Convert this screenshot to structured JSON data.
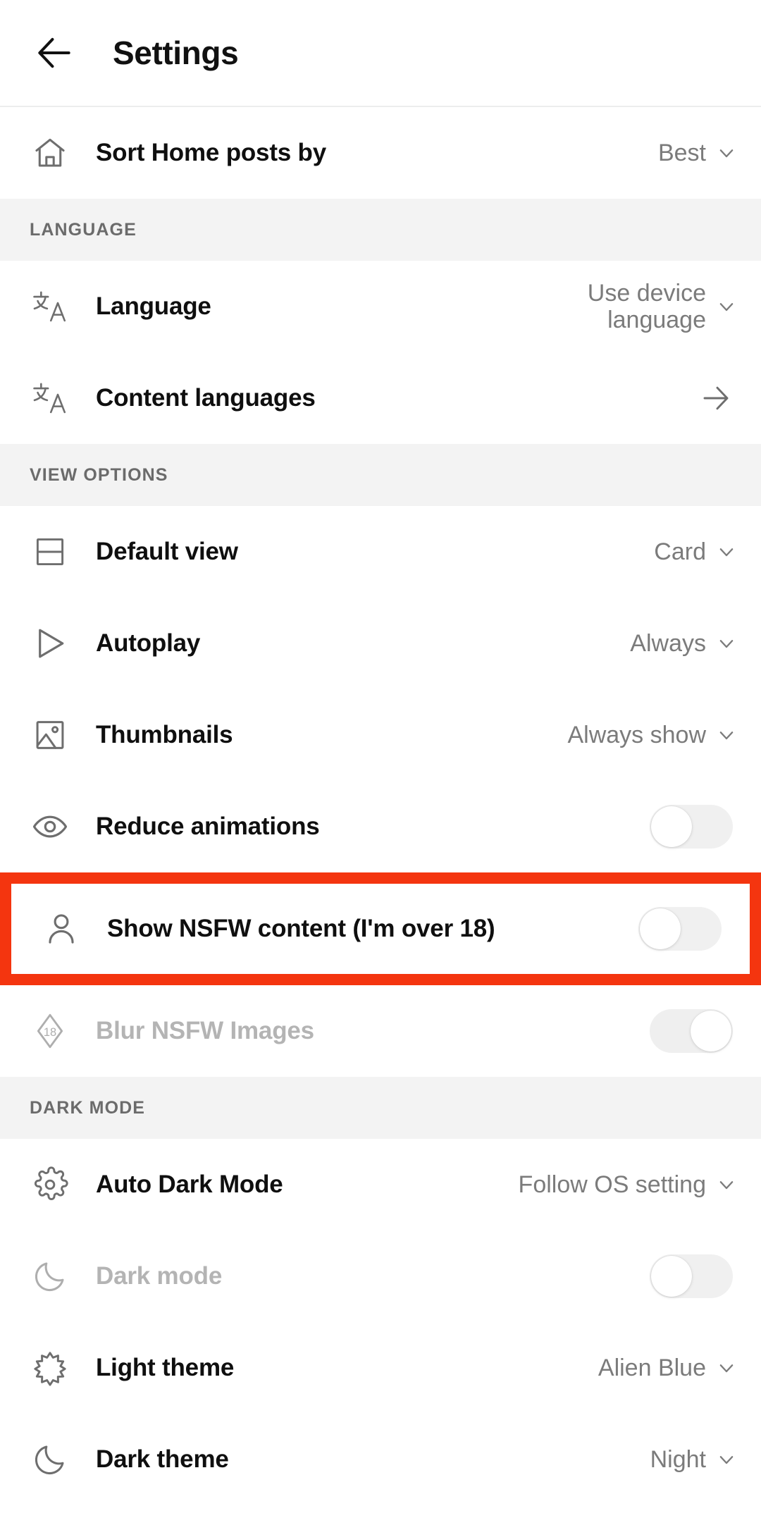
{
  "header": {
    "title": "Settings",
    "back_icon": "arrow-left-icon"
  },
  "sections": [
    {
      "id": "top",
      "heading": null,
      "rows": [
        {
          "id": "sort-home-posts-by",
          "icon": "home-icon",
          "label": "Sort Home posts by",
          "control": "dropdown",
          "value": "Best"
        }
      ]
    },
    {
      "id": "language",
      "heading": "LANGUAGE",
      "rows": [
        {
          "id": "language",
          "icon": "translate-icon",
          "label": "Language",
          "control": "dropdown",
          "value": "Use device language"
        },
        {
          "id": "content-languages",
          "icon": "translate-icon",
          "label": "Content languages",
          "control": "navigate",
          "value": ""
        }
      ]
    },
    {
      "id": "view-options",
      "heading": "VIEW OPTIONS",
      "rows": [
        {
          "id": "default-view",
          "icon": "card-view-icon",
          "label": "Default view",
          "control": "dropdown",
          "value": "Card"
        },
        {
          "id": "autoplay",
          "icon": "play-icon",
          "label": "Autoplay",
          "control": "dropdown",
          "value": "Always"
        },
        {
          "id": "thumbnails",
          "icon": "image-icon",
          "label": "Thumbnails",
          "control": "dropdown",
          "value": "Always show"
        },
        {
          "id": "reduce-animations",
          "icon": "eye-icon",
          "label": "Reduce animations",
          "control": "toggle",
          "toggle_state": "off",
          "disabled": false
        },
        {
          "id": "show-nsfw-content",
          "icon": "person-icon",
          "label": "Show NSFW content (I'm over 18)",
          "control": "toggle",
          "toggle_state": "off",
          "disabled": false,
          "highlighted": true
        },
        {
          "id": "blur-nsfw-images",
          "icon": "eighteen-badge-icon",
          "label": "Blur NSFW Images",
          "control": "toggle",
          "toggle_state": "on",
          "disabled": true
        }
      ]
    },
    {
      "id": "dark-mode",
      "heading": "DARK MODE",
      "rows": [
        {
          "id": "auto-dark-mode",
          "icon": "gear-icon",
          "label": "Auto Dark Mode",
          "control": "dropdown",
          "value": "Follow OS setting"
        },
        {
          "id": "dark-mode",
          "icon": "moon-icon",
          "label": "Dark mode",
          "control": "toggle",
          "toggle_state": "off",
          "disabled": true
        },
        {
          "id": "light-theme",
          "icon": "sun-icon",
          "label": "Light theme",
          "control": "dropdown",
          "value": "Alien Blue"
        },
        {
          "id": "dark-theme",
          "icon": "moon-icon",
          "label": "Dark theme",
          "control": "dropdown",
          "value": "Night"
        }
      ]
    }
  ],
  "colors": {
    "highlight_red": "#f4350f",
    "section_background": "#f3f3f3",
    "row_background": "#ffffff",
    "label_text": "#0f0f0f",
    "value_text": "#7b7b7b",
    "disabled_text": "#b4b4b4",
    "icon_stroke": "#6e6e6e",
    "toggle_track": "#f0f0f0",
    "toggle_knob": "#ffffff"
  }
}
